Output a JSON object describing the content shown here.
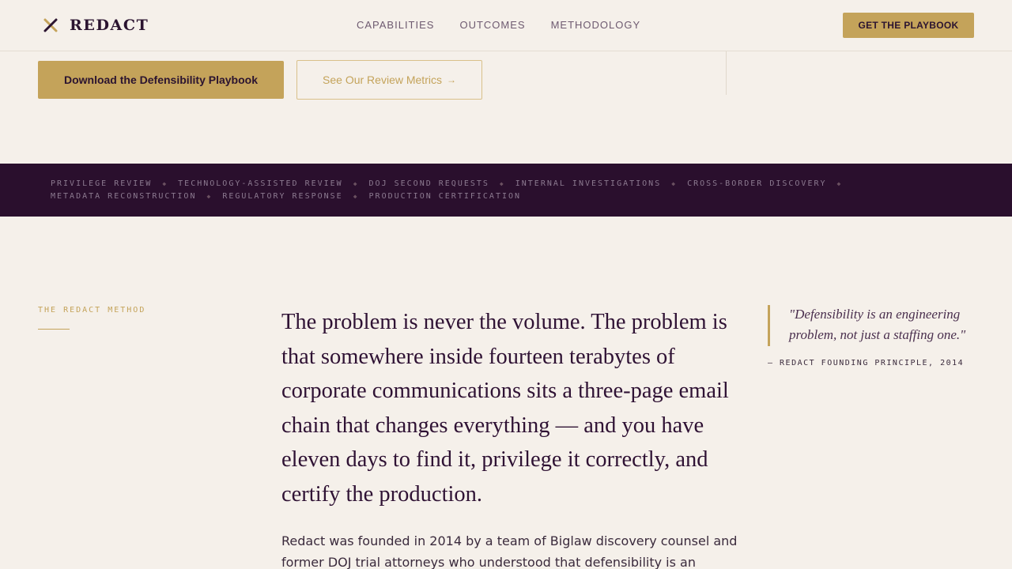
{
  "header": {
    "brand": "REDACT",
    "nav": [
      "CAPABILITIES",
      "OUTCOMES",
      "METHODOLOGY"
    ],
    "cta": "GET THE PLAYBOOK"
  },
  "hero": {
    "primary_button": "Download the Defensibility Playbook",
    "secondary_button": "See Our Review Metrics",
    "secondary_arrow": "→"
  },
  "ticker": {
    "items": [
      "PRIVILEGE REVIEW",
      "TECHNOLOGY-ASSISTED REVIEW",
      "DOJ SECOND REQUESTS",
      "INTERNAL INVESTIGATIONS",
      "CROSS-BORDER DISCOVERY",
      "METADATA RECONSTRUCTION",
      "REGULATORY RESPONSE",
      "PRODUCTION CERTIFICATION"
    ],
    "separator": "◆"
  },
  "method": {
    "label": "THE REDACT METHOD",
    "lead": "The problem is never the volume. The problem is that somewhere inside fourteen terabytes of corporate communications sits a three-page email chain that changes everything — and you have eleven days to find it, privilege it correctly, and certify the production.",
    "body": "Redact was founded in 2014 by a team of Biglaw discovery counsel and former DOJ trial attorneys who understood that defensibility is an",
    "quote": "\"Defensibility is an engineering problem, not just a staffing one.\"",
    "quote_attribution": "— REDACT FOUNDING PRINCIPLE, 2014"
  },
  "colors": {
    "background": "#f5f0ea",
    "accent_gold": "#c4a35a",
    "deep_plum": "#2a0f2d"
  },
  "icons": {
    "logo": "crossed-x-icon"
  }
}
